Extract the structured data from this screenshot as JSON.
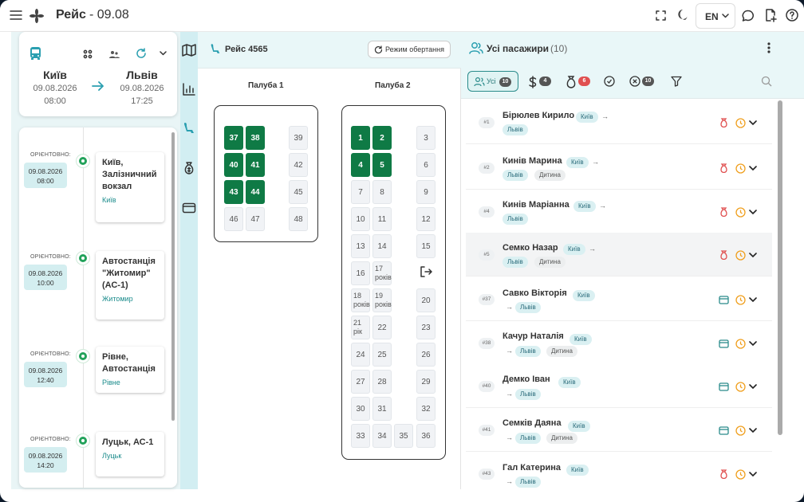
{
  "header": {
    "title": "Рейс",
    "date": "- 09.08",
    "lang": "EN"
  },
  "route": {
    "from": {
      "city": "Київ",
      "date": "09.08.2026",
      "time": "08:00"
    },
    "to": {
      "city": "Львів",
      "date": "09.08.2026",
      "time": "17:25"
    }
  },
  "stops": [
    {
      "label": "ОРІЄНТОВНО:",
      "date": "09.08.2026",
      "time": "08:00",
      "name": "Київ, Залізничний вокзал",
      "city": "Київ"
    },
    {
      "label": "ОРІЄНТОВНО:",
      "date": "09.08.2026",
      "time": "10:00",
      "name": "Автостанція \"Житомир\" (АС-1)",
      "city": "Житомир"
    },
    {
      "label": "ОРІЄНТОВНО:",
      "date": "09.08.2026",
      "time": "12:40",
      "name": "Рівне, Автостанція",
      "city": "Рівне"
    },
    {
      "label": "ОРІЄНТОВНО:",
      "date": "09.08.2026",
      "time": "14:20",
      "name": "Луцьк, АС-1",
      "city": "Луцьк"
    }
  ],
  "trip": {
    "title": "Рейс 4565",
    "rotate_label": "Режим обертання"
  },
  "decks": {
    "deck1": {
      "title": "Палуба 1",
      "seats": [
        {
          "n": "37",
          "occ": true
        },
        {
          "n": "38",
          "occ": true
        },
        {
          "n": "39",
          "occ": false
        },
        {
          "n": "40",
          "occ": true
        },
        {
          "n": "41",
          "occ": true
        },
        {
          "n": "42",
          "occ": false
        },
        {
          "n": "43",
          "occ": true
        },
        {
          "n": "44",
          "occ": true
        },
        {
          "n": "45",
          "occ": false
        },
        {
          "n": "46",
          "occ": false
        },
        {
          "n": "47",
          "occ": false
        },
        {
          "n": "48",
          "occ": false
        }
      ]
    },
    "deck2": {
      "title": "Палуба 2",
      "seats": [
        {
          "n": "1",
          "occ": true
        },
        {
          "n": "2",
          "occ": true
        },
        {
          "n": "3",
          "occ": false
        },
        {
          "n": "4",
          "occ": true
        },
        {
          "n": "5",
          "occ": true
        },
        {
          "n": "6",
          "occ": false
        },
        {
          "n": "7"
        },
        {
          "n": "8"
        },
        {
          "n": "9"
        },
        {
          "n": "10"
        },
        {
          "n": "11"
        },
        {
          "n": "12"
        },
        {
          "n": "13"
        },
        {
          "n": "14"
        },
        {
          "n": "15"
        },
        {
          "n": "16"
        },
        {
          "n": "17 років"
        },
        {
          "n": "18 років"
        },
        {
          "n": "19 років"
        },
        {
          "n": "20"
        },
        {
          "n": "21 рік"
        },
        {
          "n": "22"
        },
        {
          "n": "23"
        },
        {
          "n": "24"
        },
        {
          "n": "25"
        },
        {
          "n": "26"
        },
        {
          "n": "27"
        },
        {
          "n": "28"
        },
        {
          "n": "29"
        },
        {
          "n": "30"
        },
        {
          "n": "31"
        },
        {
          "n": "32"
        },
        {
          "n": "33"
        },
        {
          "n": "34"
        },
        {
          "n": "35"
        },
        {
          "n": "36"
        }
      ]
    }
  },
  "passengers_panel": {
    "title": "Усі пасажири",
    "count": "(10)",
    "filters": {
      "all_label": "Усі",
      "all_count": "10",
      "money_count": "4",
      "bag_count": "6",
      "cancel_count": "10"
    }
  },
  "passengers": [
    {
      "num": "#1",
      "name": "Бірюлев Кирило",
      "from": "Київ",
      "to": "Львів",
      "child": "",
      "icon": "bag"
    },
    {
      "num": "#2",
      "name": "Кинів Марина",
      "from": "Київ",
      "to": "Львів",
      "child": "Дитина",
      "icon": "bag"
    },
    {
      "num": "#4",
      "name": "Кинів Маріанна",
      "from": "Київ",
      "to": "Львів",
      "child": "",
      "icon": "bag"
    },
    {
      "num": "#5",
      "name": "Семко Назар",
      "from": "Київ",
      "to": "Львів",
      "child": "Дитина",
      "icon": "bag"
    },
    {
      "num": "#37",
      "name": "Савко Вікторія",
      "from": "Київ",
      "to": "Львів",
      "child": "",
      "icon": "card"
    },
    {
      "num": "#38",
      "name": "Качур Наталія",
      "from": "Київ",
      "to": "Львів",
      "child": "Дитина",
      "icon": "card"
    },
    {
      "num": "#40",
      "name": "Демко Іван",
      "from": "Київ",
      "to": "Львів",
      "child": "",
      "icon": "card"
    },
    {
      "num": "#41",
      "name": "Семків Даяна",
      "from": "Київ",
      "to": "Львів",
      "child": "Дитина",
      "icon": "card"
    },
    {
      "num": "#43",
      "name": "Гал Катерина",
      "from": "Київ",
      "to": "Львів",
      "child": "",
      "icon": "bag"
    }
  ],
  "colors": {
    "accent": "#0f7a45",
    "teal": "#2a8b8b",
    "panel": "#e9f7f8",
    "bag_red": "#e05050",
    "clock": "#f0a020"
  }
}
